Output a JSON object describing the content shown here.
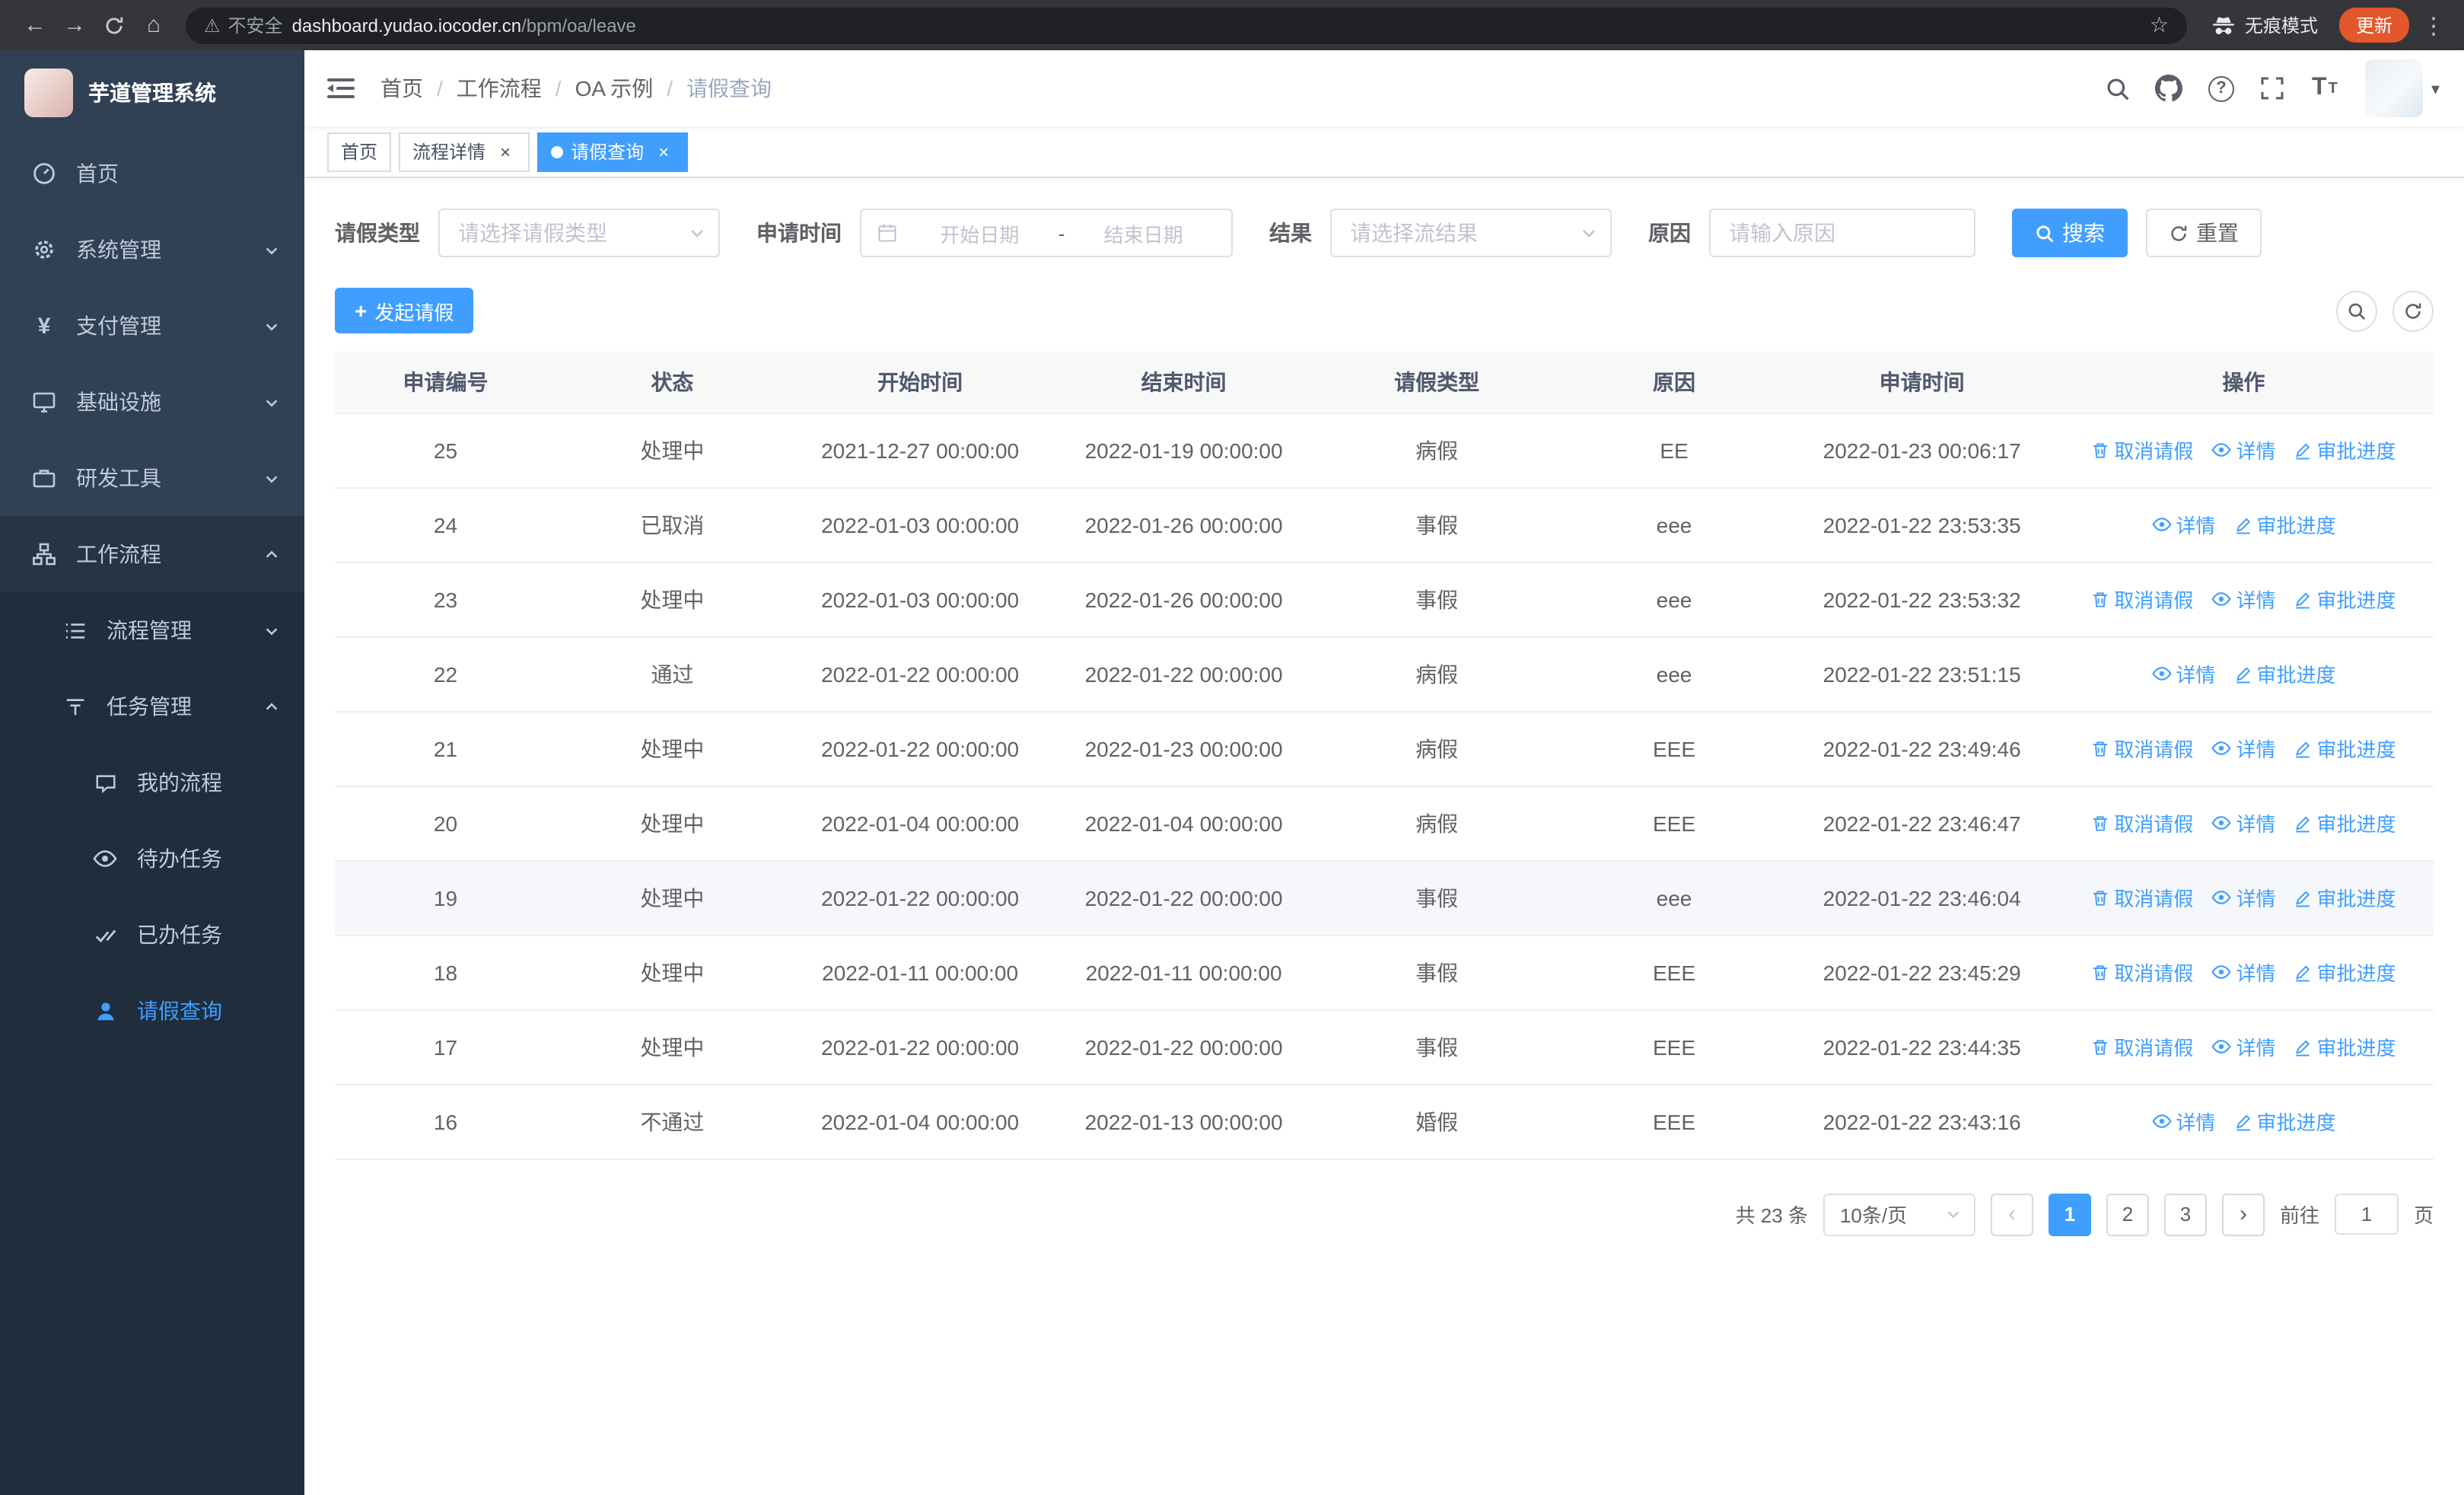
{
  "browser": {
    "security_label": "不安全",
    "url_domain": "dashboard.yudao.iocoder.cn",
    "url_path": "/bpm/oa/leave",
    "incognito_label": "无痕模式",
    "update_label": "更新"
  },
  "icons": {
    "back": "←",
    "forward": "→",
    "home": "⌂",
    "warning": "⚠",
    "star": "☆",
    "more": "⋮",
    "close": "×",
    "prev": "‹",
    "next": "›",
    "caret_down": "▾",
    "question": "?",
    "plus": "+",
    "font_large": "T",
    "font_small": "T",
    "breadcrumb_separator": "/",
    "yen": "¥"
  },
  "sidebar": {
    "title": "芋道管理系统",
    "home": "首页",
    "system": "系统管理",
    "payment": "支付管理",
    "infra": "基础设施",
    "devtools": "研发工具",
    "workflow": "工作流程",
    "process_mgmt": "流程管理",
    "task_mgmt": "任务管理",
    "my_process": "我的流程",
    "todo_tasks": "待办任务",
    "done_tasks": "已办任务",
    "leave_query": "请假查询"
  },
  "breadcrumb": [
    "首页",
    "工作流程",
    "OA 示例",
    "请假查询"
  ],
  "tabs": [
    {
      "label": "首页"
    },
    {
      "label": "流程详情"
    },
    {
      "label": "请假查询"
    }
  ],
  "filters": {
    "leave_type_label": "请假类型",
    "leave_type_placeholder": "请选择请假类型",
    "apply_time_label": "申请时间",
    "start_placeholder": "开始日期",
    "range_separator": "-",
    "end_placeholder": "结束日期",
    "result_label": "结果",
    "result_placeholder": "请选择流结果",
    "reason_label": "原因",
    "reason_placeholder": "请输入原因",
    "search_label": "搜索",
    "reset_label": "重置"
  },
  "toolbar": {
    "create_label": "发起请假"
  },
  "table": {
    "columns": [
      "申请编号",
      "状态",
      "开始时间",
      "结束时间",
      "请假类型",
      "原因",
      "申请时间",
      "操作"
    ],
    "action_defs": {
      "cancel": {
        "label": "取消请假",
        "icon": "delete-icon"
      },
      "detail": {
        "label": "详情",
        "icon": "view-icon"
      },
      "progress": {
        "label": "审批进度",
        "icon": "edit-icon"
      }
    },
    "rows": [
      {
        "id": "25",
        "status": "处理中",
        "start": "2021-12-27 00:00:00",
        "end": "2022-01-19 00:00:00",
        "type": "病假",
        "reason": "EE",
        "applyTime": "2022-01-23 00:06:17",
        "actions": [
          "cancel",
          "detail",
          "progress"
        ]
      },
      {
        "id": "24",
        "status": "已取消",
        "start": "2022-01-03 00:00:00",
        "end": "2022-01-26 00:00:00",
        "type": "事假",
        "reason": "eee",
        "applyTime": "2022-01-22 23:53:35",
        "actions": [
          "detail",
          "progress"
        ]
      },
      {
        "id": "23",
        "status": "处理中",
        "start": "2022-01-03 00:00:00",
        "end": "2022-01-26 00:00:00",
        "type": "事假",
        "reason": "eee",
        "applyTime": "2022-01-22 23:53:32",
        "actions": [
          "cancel",
          "detail",
          "progress"
        ]
      },
      {
        "id": "22",
        "status": "通过",
        "start": "2022-01-22 00:00:00",
        "end": "2022-01-22 00:00:00",
        "type": "病假",
        "reason": "eee",
        "applyTime": "2022-01-22 23:51:15",
        "actions": [
          "detail",
          "progress"
        ]
      },
      {
        "id": "21",
        "status": "处理中",
        "start": "2022-01-22 00:00:00",
        "end": "2022-01-23 00:00:00",
        "type": "病假",
        "reason": "EEE",
        "applyTime": "2022-01-22 23:49:46",
        "actions": [
          "cancel",
          "detail",
          "progress"
        ]
      },
      {
        "id": "20",
        "status": "处理中",
        "start": "2022-01-04 00:00:00",
        "end": "2022-01-04 00:00:00",
        "type": "病假",
        "reason": "EEE",
        "applyTime": "2022-01-22 23:46:47",
        "actions": [
          "cancel",
          "detail",
          "progress"
        ]
      },
      {
        "id": "19",
        "status": "处理中",
        "start": "2022-01-22 00:00:00",
        "end": "2022-01-22 00:00:00",
        "type": "事假",
        "reason": "eee",
        "applyTime": "2022-01-22 23:46:04",
        "actions": [
          "cancel",
          "detail",
          "progress"
        ],
        "highlighted": true
      },
      {
        "id": "18",
        "status": "处理中",
        "start": "2022-01-11 00:00:00",
        "end": "2022-01-11 00:00:00",
        "type": "事假",
        "reason": "EEE",
        "applyTime": "2022-01-22 23:45:29",
        "actions": [
          "cancel",
          "detail",
          "progress"
        ]
      },
      {
        "id": "17",
        "status": "处理中",
        "start": "2022-01-22 00:00:00",
        "end": "2022-01-22 00:00:00",
        "type": "事假",
        "reason": "EEE",
        "applyTime": "2022-01-22 23:44:35",
        "actions": [
          "cancel",
          "detail",
          "progress"
        ]
      },
      {
        "id": "16",
        "status": "不通过",
        "start": "2022-01-04 00:00:00",
        "end": "2022-01-13 00:00:00",
        "type": "婚假",
        "reason": "EEE",
        "applyTime": "2022-01-22 23:43:16",
        "actions": [
          "detail",
          "progress"
        ]
      }
    ]
  },
  "pagination": {
    "total_text": "共 23 条",
    "page_size": "10条/页",
    "pages": [
      "1",
      "2",
      "3"
    ],
    "active_page": "1",
    "goto_label": "前往",
    "goto_value": "1",
    "unit_label": "页"
  },
  "colors": {
    "primary": "#409EFF",
    "sidebar_bg": "#304156",
    "submenu_bg": "#1f2d3d",
    "update_badge": "#e2572b"
  }
}
